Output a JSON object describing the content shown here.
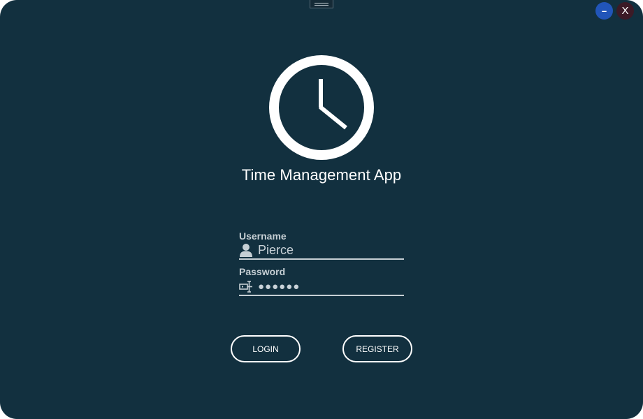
{
  "window": {
    "minimize_label": "–",
    "close_label": "X"
  },
  "app": {
    "title": "Time Management App",
    "logo_icon": "clock-icon"
  },
  "form": {
    "username": {
      "label": "Username",
      "value": "Pierce",
      "icon": "user-icon"
    },
    "password": {
      "label": "Password",
      "value": "●●●●●●",
      "icon": "password-icon"
    }
  },
  "actions": {
    "login_label": "LOGIN",
    "register_label": "REGISTER"
  },
  "colors": {
    "background": "#12303f",
    "foreground": "#ffffff",
    "muted_text": "#c6cfd4",
    "minimize_button": "#2155b9",
    "close_button": "#3c1a26"
  }
}
